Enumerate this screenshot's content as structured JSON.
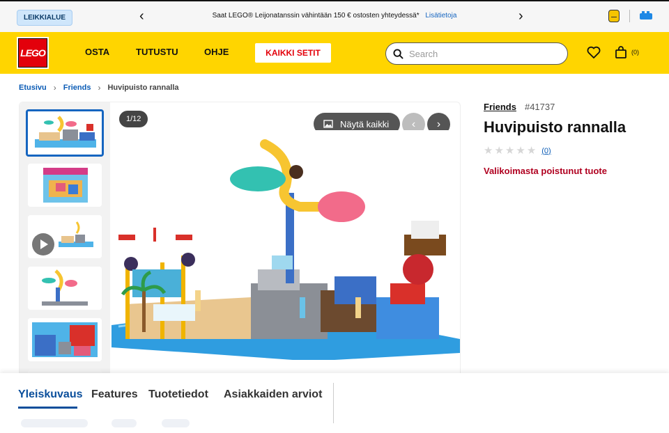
{
  "topbar": {
    "mode_button": "LEIKKIALUE",
    "promo_text": "Saat LEGO® Leijonatanssin vähintään 150 € ostosten yhteydessä*",
    "promo_link": "Lisätietoja"
  },
  "header": {
    "logo_text": "LEGO",
    "nav": [
      "OSTA",
      "TUTUSTU",
      "OHJE"
    ],
    "sets_button": "KAIKKI SETIT",
    "search_placeholder": "Search",
    "bag_count": "(0)"
  },
  "breadcrumb": {
    "items": [
      "Etusivu",
      "Friends"
    ],
    "current": "Huvipuisto rannalla"
  },
  "gallery": {
    "counter": "1/12",
    "show_all": "Näytä kaikki"
  },
  "product": {
    "theme": "Friends",
    "item_number": "#41737",
    "title": "Huvipuisto rannalla",
    "rating_count": "(0)",
    "availability": "Valikoimasta poistunut tuote"
  },
  "tabs": [
    "Yleiskuvaus",
    "Features",
    "Tuotetiedot",
    "Asiakkaiden arviot"
  ],
  "colors": {
    "header_yellow": "#ffd500",
    "lego_red": "#e3000b",
    "link_blue": "#0a5bb5",
    "availability_red": "#b00020"
  }
}
